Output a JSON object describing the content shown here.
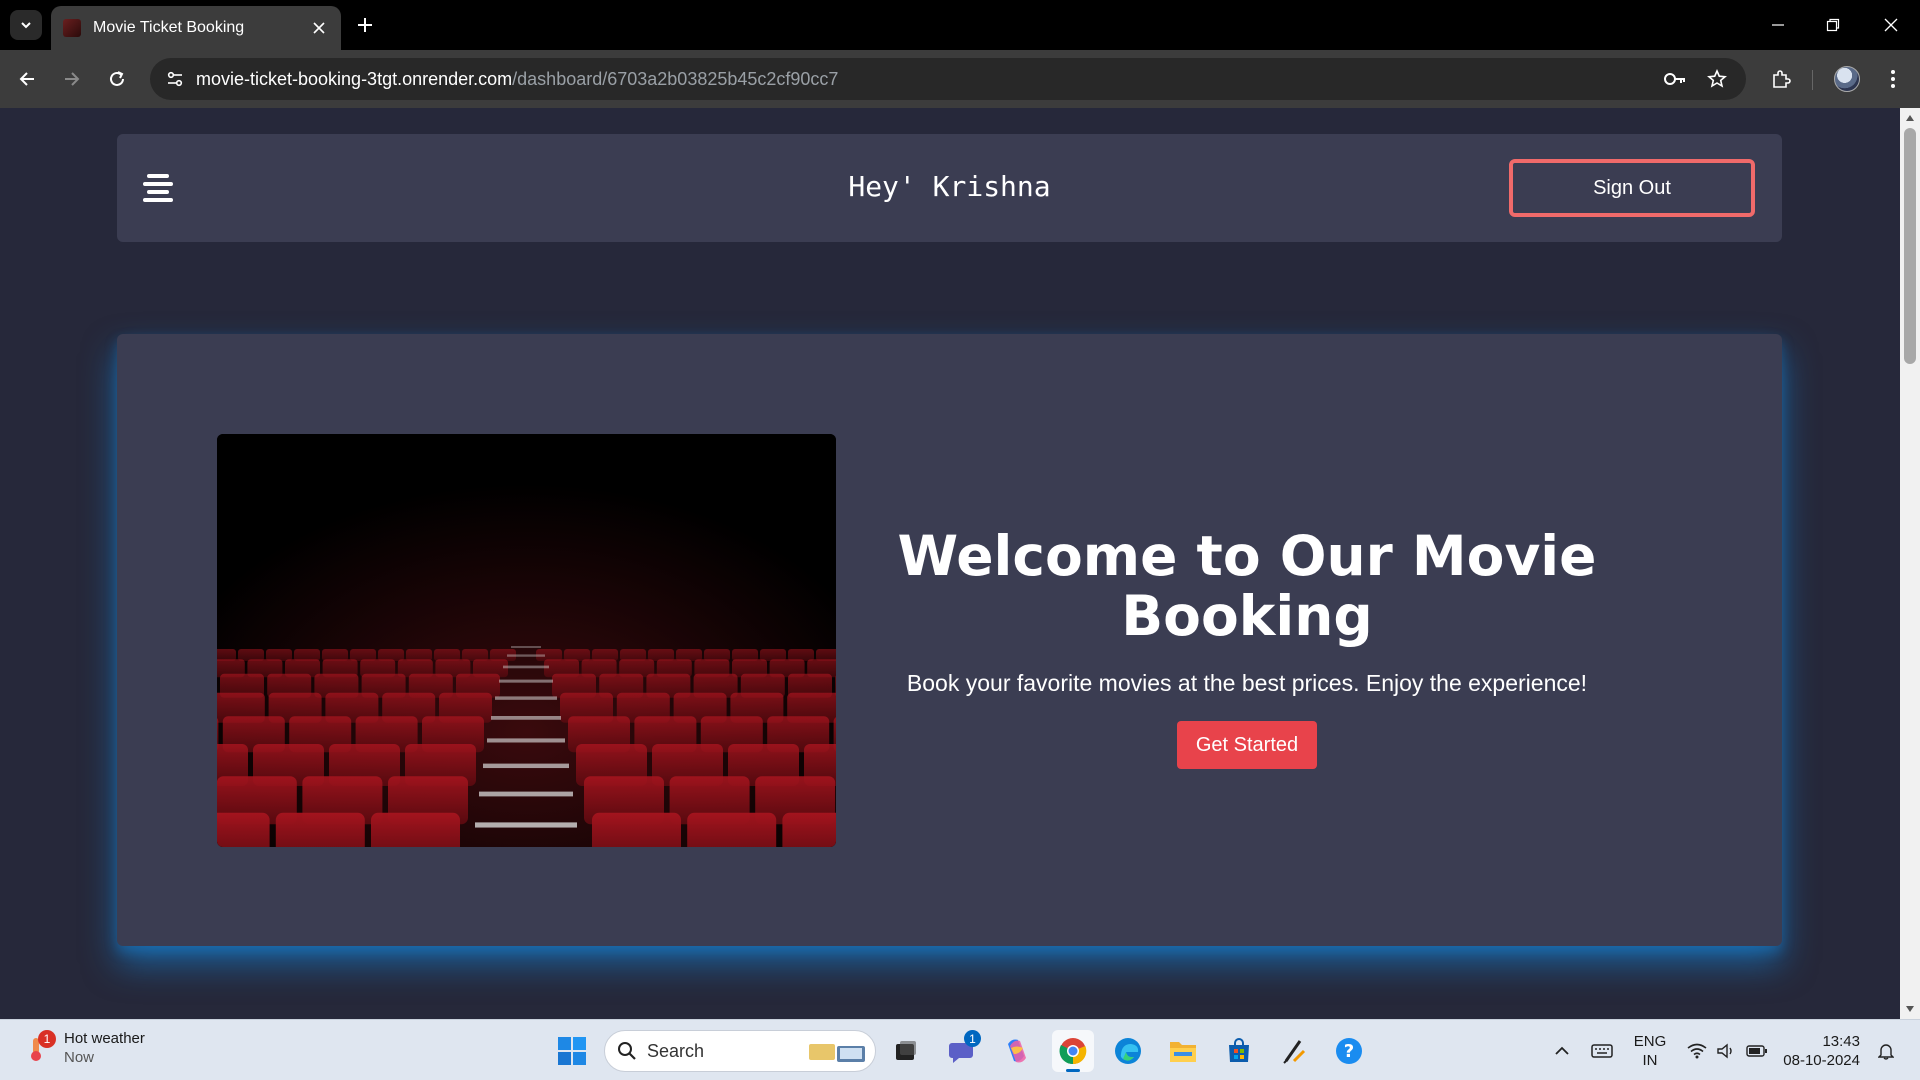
{
  "browser": {
    "tab_title": "Movie Ticket Booking",
    "url_host": "movie-ticket-booking-3tgt.onrender.com",
    "url_path": "/dashboard/6703a2b03825b45c2cf90cc7"
  },
  "page": {
    "greeting": "Hey' Krishna",
    "signout_label": "Sign Out",
    "hero": {
      "title": "Welcome to Our Movie Booking",
      "subtitle": "Book your favorite movies at the best prices. Enjoy the experience!",
      "cta_label": "Get Started"
    },
    "colors": {
      "page_bg": "#26283a",
      "card_bg": "#3b3d52",
      "signout_border": "#f06a6a",
      "cta_bg": "#e8434b",
      "glow": "#148ce6"
    }
  },
  "taskbar": {
    "weather": {
      "title": "Hot weather",
      "subtitle": "Now",
      "badge": "1"
    },
    "search_placeholder": "Search",
    "teams_badge": "1",
    "language_line1": "ENG",
    "language_line2": "IN",
    "time": "13:43",
    "date": "08-10-2024",
    "apps": [
      "start-icon",
      "search-icon",
      "task-view-icon",
      "teams-icon",
      "copilot-icon",
      "chrome-icon",
      "edge-icon",
      "file-explorer-icon",
      "store-icon",
      "pen-app-icon",
      "help-icon"
    ]
  }
}
